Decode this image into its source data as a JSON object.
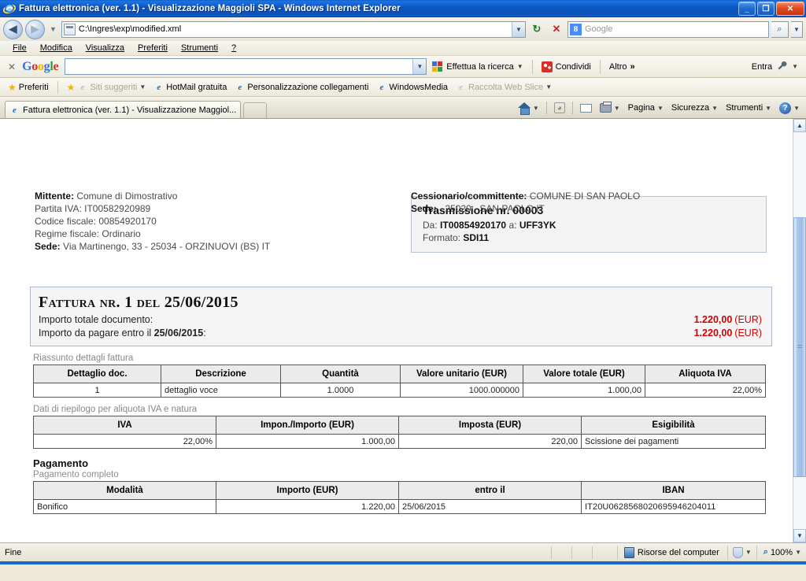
{
  "window": {
    "title": "Fattura elettronica (ver. 1.1) - Visualizzazione Maggioli SPA - Windows Internet Explorer",
    "minimize_label": "_",
    "maximize_label": "❐",
    "close_label": "✕"
  },
  "address_bar": {
    "back_label": "◀",
    "forward_label": "▶",
    "history_caret": "▼",
    "url": "C:\\Ingres\\exp\\modified.xml",
    "url_dropdown_caret": "▼",
    "refresh_label": "↻",
    "stop_label": "✕",
    "search_placeholder": "Google",
    "search_value": "",
    "search_go_label": "⌕",
    "search_drop_caret": "▼"
  },
  "menu": {
    "items": [
      {
        "label": "File"
      },
      {
        "label": "Modifica"
      },
      {
        "label": "Visualizza"
      },
      {
        "label": "Preferiti"
      },
      {
        "label": "Strumenti"
      },
      {
        "label": "?"
      }
    ]
  },
  "google_toolbar": {
    "close_label": "✕",
    "brand": [
      "G",
      "o",
      "o",
      "g",
      "l",
      "e"
    ],
    "input_value": "",
    "input_caret": "▼",
    "search_button": "Effettua la ricerca",
    "search_caret": "▼",
    "share_button": "Condividi",
    "more_button": "Altro",
    "more_chevrons": "»",
    "signin_label": "Entra",
    "settings_caret": "▼"
  },
  "favorites_bar": {
    "favorites_label": "Preferiti",
    "items": [
      {
        "label": "Siti suggeriti",
        "caret": "▼",
        "dim": true
      },
      {
        "label": "HotMail gratuita",
        "caret": "",
        "dim": false
      },
      {
        "label": "Personalizzazione collegamenti",
        "caret": "",
        "dim": false
      },
      {
        "label": "WindowsMedia",
        "caret": "",
        "dim": false
      },
      {
        "label": "Raccolta Web Slice",
        "caret": "▼",
        "dim": true
      }
    ]
  },
  "tab_bar": {
    "tab_title": "Fattura elettronica (ver. 1.1) - Visualizzazione Maggiol...",
    "new_tab_label": "",
    "commands": [
      {
        "label": "Pagina",
        "caret": "▼"
      },
      {
        "label": "Sicurezza",
        "caret": "▼"
      },
      {
        "label": "Strumenti",
        "caret": "▼"
      }
    ],
    "home_caret": "▼",
    "print_caret": "▼",
    "help_caret": "▼",
    "overflow_chevrons": "»"
  },
  "document": {
    "trasmissione": {
      "title": "Trasmissione nr. 00003",
      "da_label": "Da:",
      "da_value": "IT00854920170",
      "a_label": "a:",
      "a_value": "UFF3YK",
      "formato_label": "Formato:",
      "formato_value": "SDI11"
    },
    "mittente": {
      "mittente_label": "Mittente:",
      "mittente_value": "Comune di Dimostrativo",
      "partita_iva": "Partita IVA: IT00582920989",
      "codice_fiscale": "Codice fiscale: 00854920170",
      "regime_fiscale": "Regime fiscale: Ordinario",
      "sede_label": "Sede:",
      "sede_value": "Via Martinengo, 33 - 25034 - ORZINUOVI (BS) IT"
    },
    "cessionario": {
      "label": "Cessionario/committente:",
      "value": "COMUNE DI SAN PAOLO",
      "sede_label": "Sede:",
      "sede_value": "- 25020 - SAN PAOLO IT"
    },
    "fattura": {
      "title": "Fattura nr. 1 del 25/06/2015",
      "total_label": "Importo totale documento:",
      "total_amount": "1.220,00",
      "total_currency": "(EUR)",
      "due_label_pre": "Importo da pagare entro il",
      "due_date": "25/06/2015",
      "due_label_post": ":",
      "due_amount": "1.220,00",
      "due_currency": "(EUR)"
    },
    "details": {
      "caption": "Riassunto dettagli fattura",
      "headers": [
        "Dettaglio doc.",
        "Descrizione",
        "Quantità",
        "Valore unitario (EUR)",
        "Valore totale (EUR)",
        "Aliquota IVA"
      ],
      "rows": [
        {
          "dettaglio": "1",
          "descrizione": "dettaglio voce",
          "quantita": "1.0000",
          "valore_unitario": "1000.000000",
          "valore_totale": "1.000,00",
          "aliquota": "22,00%"
        }
      ]
    },
    "riepilogo": {
      "caption": "Dati di riepilogo per aliquota IVA e natura",
      "headers": [
        "IVA",
        "Impon./Importo (EUR)",
        "Imposta (EUR)",
        "Esigibilità"
      ],
      "rows": [
        {
          "iva": "22,00%",
          "imponibile": "1.000,00",
          "imposta": "220,00",
          "esigibilita": "Scissione dei pagamenti"
        }
      ]
    },
    "pagamento": {
      "title": "Pagamento",
      "subtitle": "Pagamento completo",
      "headers": [
        "Modalità",
        "Importo (EUR)",
        "entro il",
        "IBAN"
      ],
      "rows": [
        {
          "modalita": "Bonifico",
          "importo": "1.220,00",
          "entro_il": "25/06/2015",
          "iban": "IT20U0628568020695946204011"
        }
      ]
    }
  },
  "scrollbar": {
    "up_label": "▲",
    "down_label": "▼"
  },
  "status_bar": {
    "status_text": "Fine",
    "zone_text": "Risorse del computer",
    "protected_caret": "▼",
    "zoom_level": "100%",
    "zoom_caret": "▼"
  },
  "colors": {
    "title_blue": "#0c54bb",
    "amount_red": "#cc0000",
    "accent_bar": "#1f64c8"
  }
}
